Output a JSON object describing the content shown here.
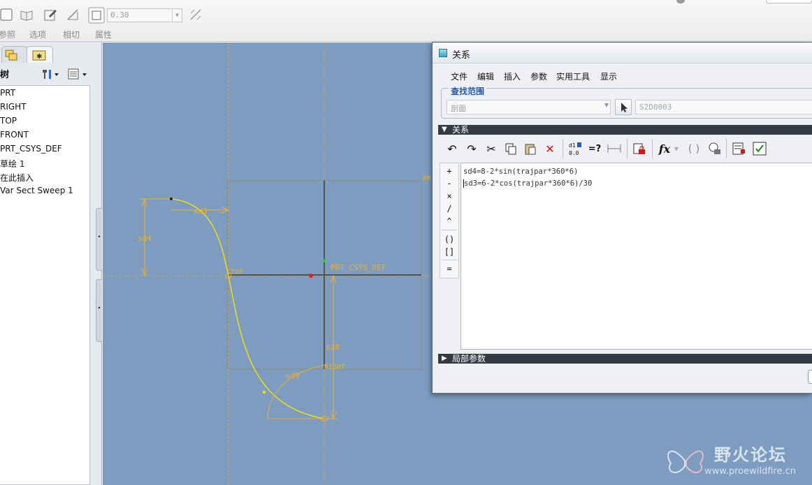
{
  "ribbon": {
    "thickness_value": "0.30",
    "labels": [
      "参照",
      "选项",
      "相切",
      "属性"
    ]
  },
  "model_tree": {
    "title": "树",
    "items": [
      "PRT",
      "RIGHT",
      "TOP",
      "FRONT",
      "PRT_CSYS_DEF",
      "草绘 1",
      "在此插入",
      "Var Sect Sweep 1"
    ]
  },
  "sketch": {
    "dims": {
      "sd3": "sd3",
      "sd4": "sd4",
      "sd8": "sd8",
      "sd9": "sd9"
    },
    "labels": {
      "top": "TOP",
      "right": "RIGHT",
      "csys": "PRT_CSYS_DEF",
      "front": "FR"
    }
  },
  "relations_dialog": {
    "title": "关系",
    "menu": [
      "文件",
      "编辑",
      "插入",
      "参数",
      "实用工具",
      "显示"
    ],
    "scope_title": "查找范围",
    "scope_type": "剖面",
    "scope_id": "S2D0003",
    "relations_section": "关系",
    "relations": [
      "sd4=8-2*sin(trajpar*360*6)",
      "sd3=6-2*cos(trajpar*360*6)/30"
    ],
    "operators": [
      "+",
      "-",
      "×",
      "/",
      "^",
      "()",
      "[]",
      "="
    ],
    "local_params_section": "局部参数"
  },
  "watermark": {
    "title": "野火论坛",
    "url": "www.proewildfire.cn"
  },
  "colors": {
    "graphics_bg": "#7d9cbf",
    "sketch_yellow": "#f2d600",
    "dim_orange": "#f0b030",
    "section_bar": "#343b45"
  }
}
